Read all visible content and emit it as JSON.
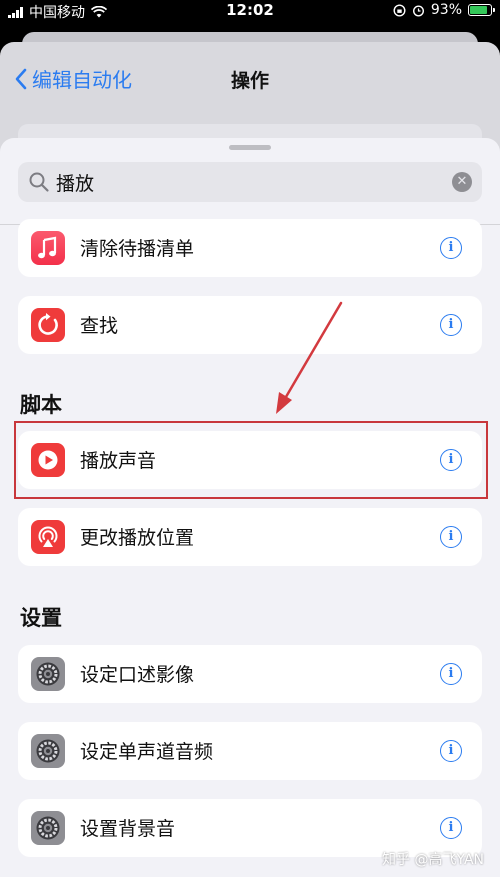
{
  "status_bar": {
    "carrier": "中国移动",
    "time": "12:02",
    "battery": "93%",
    "battery_level": 0.93
  },
  "nav": {
    "back_label": "编辑自动化",
    "title": "操作"
  },
  "search": {
    "value": "播放"
  },
  "rows_top": [
    {
      "label": "清除待播清单",
      "icon": "music-note-icon"
    },
    {
      "label": "查找",
      "icon": "refresh-icon"
    }
  ],
  "sections": [
    {
      "title": "脚本",
      "items": [
        {
          "label": "播放声音",
          "icon": "play-sound-icon"
        },
        {
          "label": "更改播放位置",
          "icon": "airplay-icon"
        }
      ]
    },
    {
      "title": "设置",
      "items": [
        {
          "label": "设定口述影像",
          "icon": "gear-icon"
        },
        {
          "label": "设定单声道音频",
          "icon": "gear-icon"
        },
        {
          "label": "设置背景音",
          "icon": "gear-icon"
        }
      ]
    }
  ],
  "info_glyph": "i",
  "clear_glyph": "✕",
  "watermark": "知乎 @高飞YAN",
  "colors": {
    "accent": "#2b7cf0",
    "highlight": "#c8373c",
    "icon_red": "#ef3b3b"
  }
}
